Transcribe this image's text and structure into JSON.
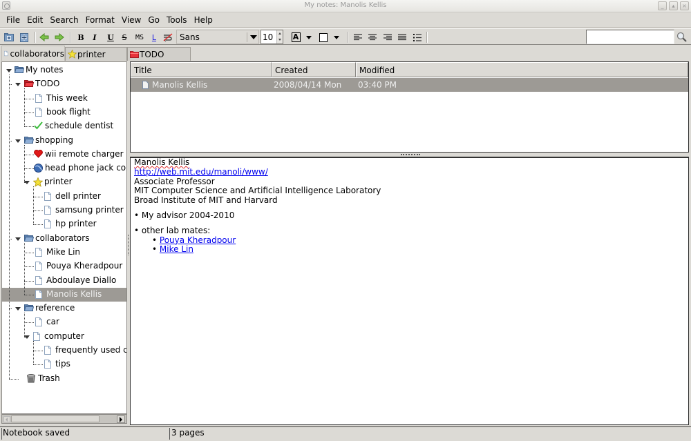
{
  "window": {
    "title": "My notes: Manolis Kellis",
    "controls": [
      "minimize",
      "maximize",
      "close"
    ]
  },
  "menubar": {
    "items": [
      {
        "label": "File",
        "mnemonic": "F"
      },
      {
        "label": "Edit",
        "mnemonic": "E"
      },
      {
        "label": "Search",
        "mnemonic": "S"
      },
      {
        "label": "Format",
        "mnemonic": "m"
      },
      {
        "label": "View",
        "mnemonic": "V"
      },
      {
        "label": "Go",
        "mnemonic": "G"
      },
      {
        "label": "Tools",
        "mnemonic": "T"
      },
      {
        "label": "Help",
        "mnemonic": "H"
      }
    ]
  },
  "toolbar": {
    "new_folder": "new-folder-icon",
    "new_page": "new-page-icon",
    "back": "back-arrow-icon",
    "forward": "forward-arrow-icon",
    "bold": "B",
    "italic": "I",
    "underline": "U",
    "strike": "S",
    "monospace": "MS",
    "link": "L",
    "no_wrap": "no-wrap-icon",
    "font_family": "Sans",
    "font_size": "10",
    "font_fg_label": "A",
    "align_left": "align-left-icon",
    "align_center": "align-center-icon",
    "align_right": "align-right-icon",
    "align_justify": "align-justify-icon",
    "bullet_list": "bullet-list-icon",
    "search_value": "",
    "search_icon": "magnifier-icon"
  },
  "tabs": [
    {
      "label": "collaborators",
      "icon": "page-icon",
      "active": true
    },
    {
      "label": "printer",
      "icon": "star-icon",
      "active": false
    },
    {
      "label": "TODO",
      "icon": "red-folder-icon",
      "active": false
    }
  ],
  "tree": {
    "items": [
      {
        "label": "My notes",
        "icon": "folder-open-blue",
        "depth": 0,
        "expanded": true
      },
      {
        "label": "TODO",
        "icon": "folder-open-red",
        "depth": 1,
        "expanded": true
      },
      {
        "label": "This week",
        "icon": "page",
        "depth": 2
      },
      {
        "label": "book flight",
        "icon": "page",
        "depth": 2
      },
      {
        "label": "schedule dentist",
        "icon": "check",
        "depth": 2
      },
      {
        "label": "shopping",
        "icon": "folder-open-blue",
        "depth": 1,
        "expanded": true
      },
      {
        "label": "wii remote charger",
        "icon": "heart",
        "depth": 2
      },
      {
        "label": "head phone jack conve",
        "icon": "globe",
        "depth": 2
      },
      {
        "label": "printer",
        "icon": "star",
        "depth": 2,
        "expanded": true
      },
      {
        "label": "dell printer",
        "icon": "page",
        "depth": 3
      },
      {
        "label": "samsung printer",
        "icon": "page",
        "depth": 3
      },
      {
        "label": "hp printer",
        "icon": "page",
        "depth": 3
      },
      {
        "label": "collaborators",
        "icon": "folder-open-blue",
        "depth": 1,
        "expanded": true
      },
      {
        "label": "Mike Lin",
        "icon": "page",
        "depth": 2
      },
      {
        "label": "Pouya Kheradpour",
        "icon": "page",
        "depth": 2
      },
      {
        "label": "Abdoulaye Diallo",
        "icon": "page",
        "depth": 2
      },
      {
        "label": "Manolis Kellis",
        "icon": "page",
        "depth": 2,
        "selected": true
      },
      {
        "label": "reference",
        "icon": "folder-open-blue",
        "depth": 1,
        "expanded": true
      },
      {
        "label": "car",
        "icon": "page",
        "depth": 2
      },
      {
        "label": "computer",
        "icon": "page",
        "depth": 2,
        "expanded": true
      },
      {
        "label": "frequently used com",
        "icon": "page",
        "depth": 3
      },
      {
        "label": "tips",
        "icon": "page",
        "depth": 3
      },
      {
        "label": "Trash",
        "icon": "trash",
        "depth": 1
      }
    ]
  },
  "list": {
    "columns": [
      "Title",
      "Created",
      "Modified"
    ],
    "rows": [
      {
        "title": "Manolis Kellis",
        "created": "2008/04/14 Mon",
        "modified": "03:40 PM",
        "selected": true
      }
    ]
  },
  "editor": {
    "name": "Manolis Kellis",
    "url": "http://web.mit.edu/manoli/www/",
    "lines": [
      "Associate Professor",
      "MIT Computer Science and Artificial Intelligence Laboratory",
      "Broad Institute of MIT and Harvard"
    ],
    "bullet1": "My advisor 2004-2010",
    "bullet2": "other lab mates:",
    "sub_links": [
      "Pouya Kheradpour",
      "Mike Lin"
    ],
    "bullet_char": "•"
  },
  "status": {
    "left": "Notebook saved",
    "right": "3 pages"
  },
  "colors": {
    "window_bg": "#dcdad5",
    "selection_bg": "#9d9a95",
    "link": "#0000ee",
    "todo_folder": "#e8323a",
    "folder_blue": "#5b7fad"
  }
}
